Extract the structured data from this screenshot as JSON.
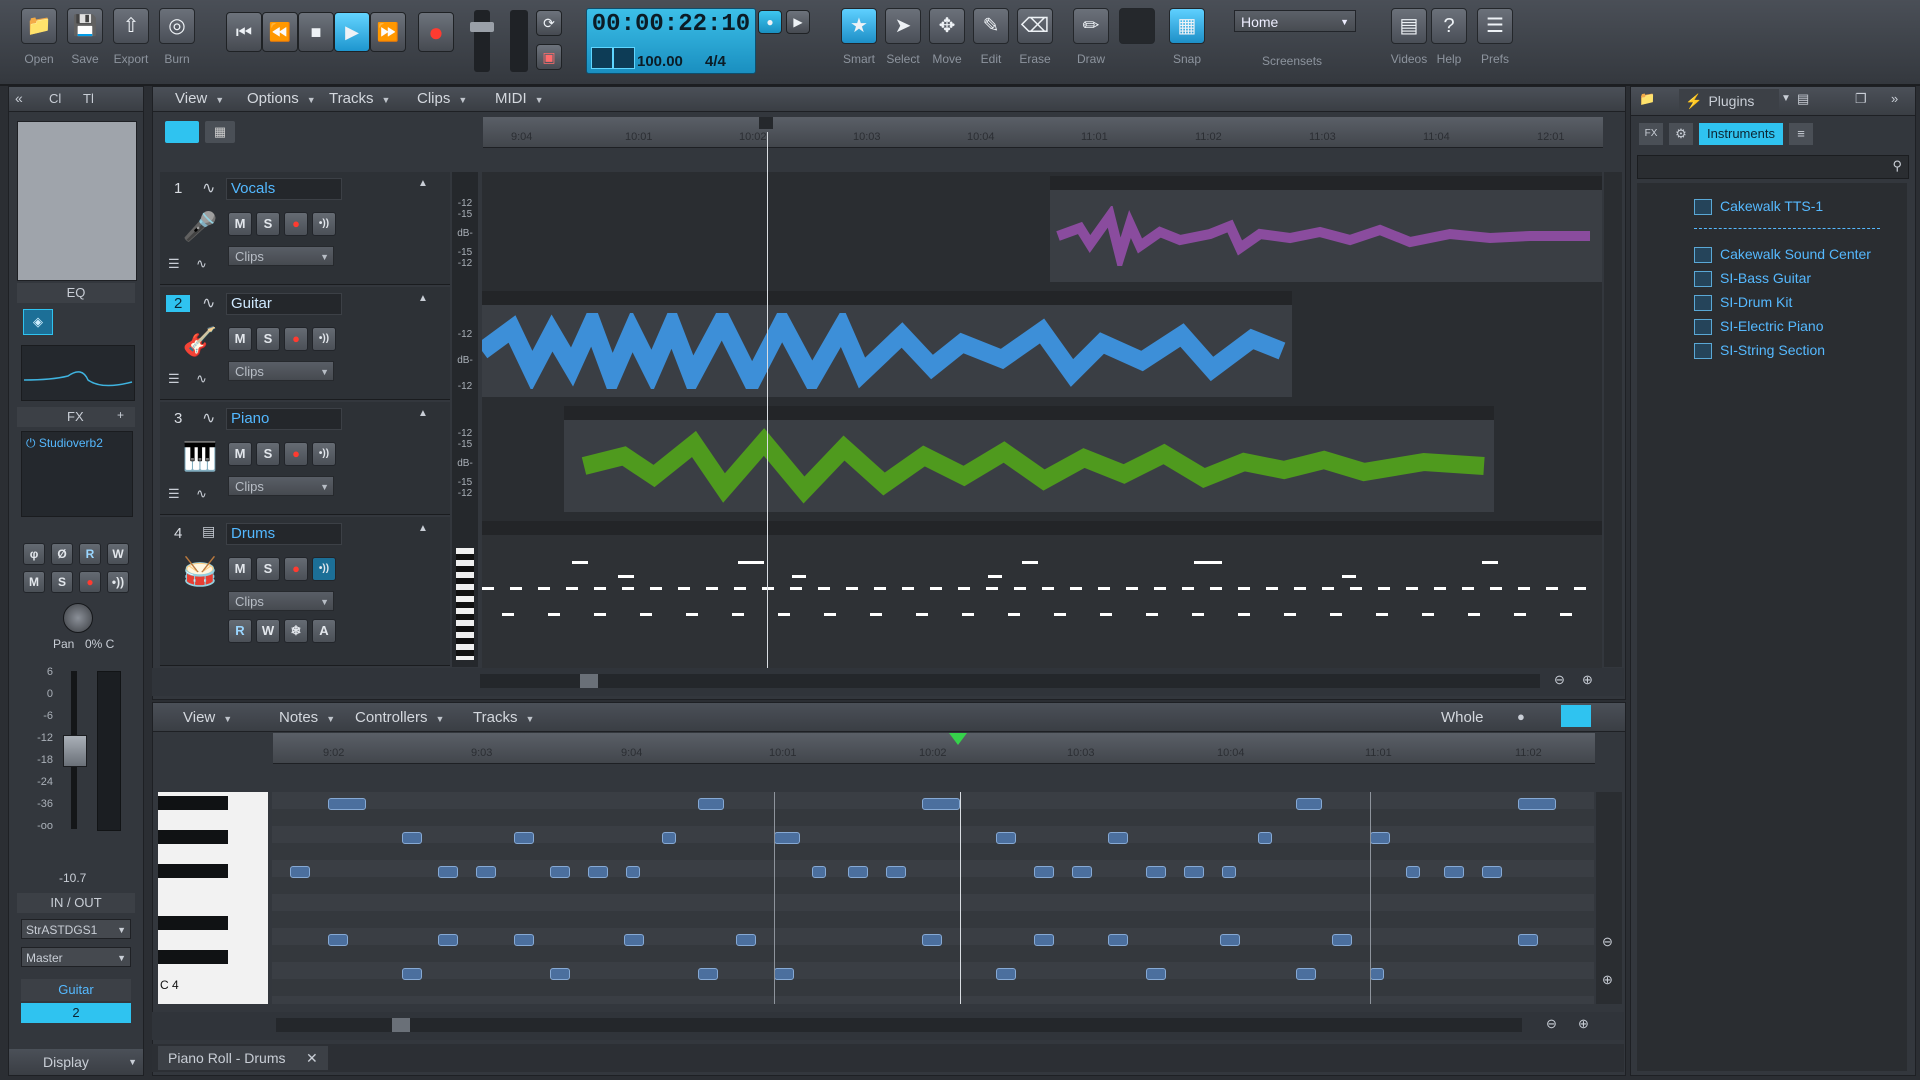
{
  "topbar": {
    "file_buttons": [
      {
        "label": "Open",
        "icon": "folder-icon"
      },
      {
        "label": "Save",
        "icon": "save-icon"
      },
      {
        "label": "Export",
        "icon": "export-icon"
      },
      {
        "label": "Burn",
        "icon": "burn-icon"
      }
    ],
    "clock": {
      "time": "00:00:22:10",
      "tempo": "100.00",
      "meter": "4/4"
    },
    "tools": [
      "Smart",
      "Select",
      "Move",
      "Edit",
      "Erase",
      "Draw",
      "Snap"
    ],
    "screenset": {
      "selected": "Home",
      "label": "Screensets"
    },
    "right_buttons": [
      "Videos",
      "Help",
      "Prefs"
    ]
  },
  "inspector": {
    "tabs": [
      "Cl",
      "Tl"
    ],
    "eq_label": "EQ",
    "fx_label": "FX",
    "fx_plugin": "Studioverb2",
    "pan_label": "Pan",
    "pan_value": "0% C",
    "fader_value": "-10.7",
    "fader_scale": [
      "6",
      "0",
      "-6",
      "-12",
      "-18",
      "-24",
      "-36",
      "-oo"
    ],
    "inout_label": "IN / OUT",
    "input": "StrASTDGS1",
    "output": "Master",
    "track_name": "Guitar",
    "track_number": "2",
    "display_label": "Display"
  },
  "track_view": {
    "menus": [
      "View",
      "Options",
      "Tracks",
      "Clips",
      "MIDI"
    ],
    "ruler": [
      "9:04",
      "10:01",
      "10:02",
      "10:03",
      "10:04",
      "11:01",
      "11:02",
      "11:03",
      "11:04",
      "12:01"
    ],
    "tracks": [
      {
        "number": "1",
        "name": "Vocals",
        "clips_label": "Clips",
        "meter": [
          "-12",
          "-15",
          "dB-",
          "-15",
          "-12"
        ]
      },
      {
        "number": "2",
        "name": "Guitar",
        "clips_label": "Clips",
        "meter": [
          "-12",
          "dB-",
          "-12"
        ]
      },
      {
        "number": "3",
        "name": "Piano",
        "clips_label": "Clips",
        "meter": [
          "-12",
          "-15",
          "dB-",
          "-15",
          "-12"
        ]
      },
      {
        "number": "4",
        "name": "Drums",
        "clips_label": "Clips",
        "meter": []
      }
    ],
    "colors": {
      "vocals": "#8a4c9e",
      "guitar": "#3d8fd8",
      "piano": "#4f9a1e",
      "accent": "#2fc3f0"
    }
  },
  "piano_roll": {
    "menus": [
      "View",
      "Notes",
      "Controllers",
      "Tracks"
    ],
    "snap": "Whole",
    "ruler": [
      "9:02",
      "9:03",
      "9:04",
      "10:01",
      "10:02",
      "10:03",
      "10:04",
      "11:01",
      "11:02"
    ],
    "key_label": "C 4",
    "tab_label": "Piano Roll - Drums"
  },
  "browser": {
    "tabs": [
      "Plugins"
    ],
    "subtabs": [
      "FX",
      "Instruments"
    ],
    "instruments": [
      "Cakewalk TTS-1",
      "Cakewalk Sound Center",
      "SI-Bass Guitar",
      "SI-Drum Kit",
      "SI-Electric Piano",
      "SI-String Section"
    ]
  }
}
